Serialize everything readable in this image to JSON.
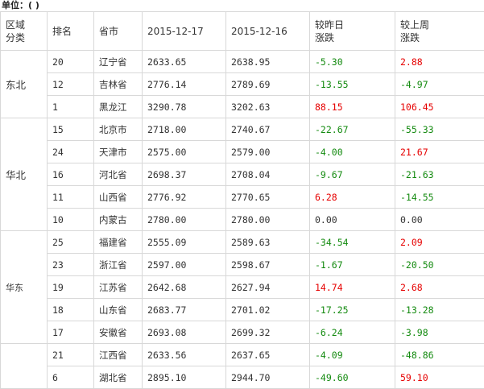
{
  "unit_label": "单位：( )",
  "headers": {
    "region": [
      "区域",
      "分类"
    ],
    "rank": "排名",
    "province": "省市",
    "date1": "2015-12-17",
    "date2": "2015-12-16",
    "day_change": [
      "较昨日",
      "涨跌"
    ],
    "week_change": [
      "较上周",
      "涨跌"
    ]
  },
  "groups": [
    {
      "region": "东北",
      "rows": [
        {
          "rank": "20",
          "province": "辽宁省",
          "v1": "2633.65",
          "v2": "2638.95",
          "day": "-5.30",
          "week": "2.88"
        },
        {
          "rank": "12",
          "province": "吉林省",
          "v1": "2776.14",
          "v2": "2789.69",
          "day": "-13.55",
          "week": "-4.97"
        },
        {
          "rank": "1",
          "province": "黑龙江",
          "v1": "3290.78",
          "v2": "3202.63",
          "day": "88.15",
          "week": "106.45"
        }
      ]
    },
    {
      "region": "华北",
      "rows": [
        {
          "rank": "15",
          "province": "北京市",
          "v1": "2718.00",
          "v2": "2740.67",
          "day": "-22.67",
          "week": "-55.33"
        },
        {
          "rank": "24",
          "province": "天津市",
          "v1": "2575.00",
          "v2": "2579.00",
          "day": "-4.00",
          "week": "21.67"
        },
        {
          "rank": "16",
          "province": "河北省",
          "v1": "2698.37",
          "v2": "2708.04",
          "day": "-9.67",
          "week": "-21.63"
        },
        {
          "rank": "11",
          "province": "山西省",
          "v1": "2776.92",
          "v2": "2770.65",
          "day": "6.28",
          "week": "-14.55"
        },
        {
          "rank": "10",
          "province": "内蒙古",
          "v1": "2780.00",
          "v2": "2780.00",
          "day": "0.00",
          "week": "0.00"
        }
      ]
    },
    {
      "region": "华东",
      "small": true,
      "rows": [
        {
          "rank": "25",
          "province": "福建省",
          "v1": "2555.09",
          "v2": "2589.63",
          "day": "-34.54",
          "week": "2.09"
        },
        {
          "rank": "23",
          "province": "浙江省",
          "v1": "2597.00",
          "v2": "2598.67",
          "day": "-1.67",
          "week": "-20.50"
        },
        {
          "rank": "19",
          "province": "江苏省",
          "v1": "2642.68",
          "v2": "2627.94",
          "day": "14.74",
          "week": "2.68"
        },
        {
          "rank": "18",
          "province": "山东省",
          "v1": "2683.77",
          "v2": "2701.02",
          "day": "-17.25",
          "week": "-13.28"
        },
        {
          "rank": "17",
          "province": "安徽省",
          "v1": "2693.08",
          "v2": "2699.32",
          "day": "-6.24",
          "week": "-3.98"
        }
      ]
    },
    {
      "region": "",
      "rows": [
        {
          "rank": "21",
          "province": "江西省",
          "v1": "2633.56",
          "v2": "2637.65",
          "day": "-4.09",
          "week": "-48.86"
        },
        {
          "rank": "6",
          "province": "湖北省",
          "v1": "2895.10",
          "v2": "2944.70",
          "day": "-49.60",
          "week": "59.10"
        }
      ]
    }
  ],
  "colors": {
    "up": "#e60000",
    "down": "#138a0f",
    "flat": "#333333"
  }
}
